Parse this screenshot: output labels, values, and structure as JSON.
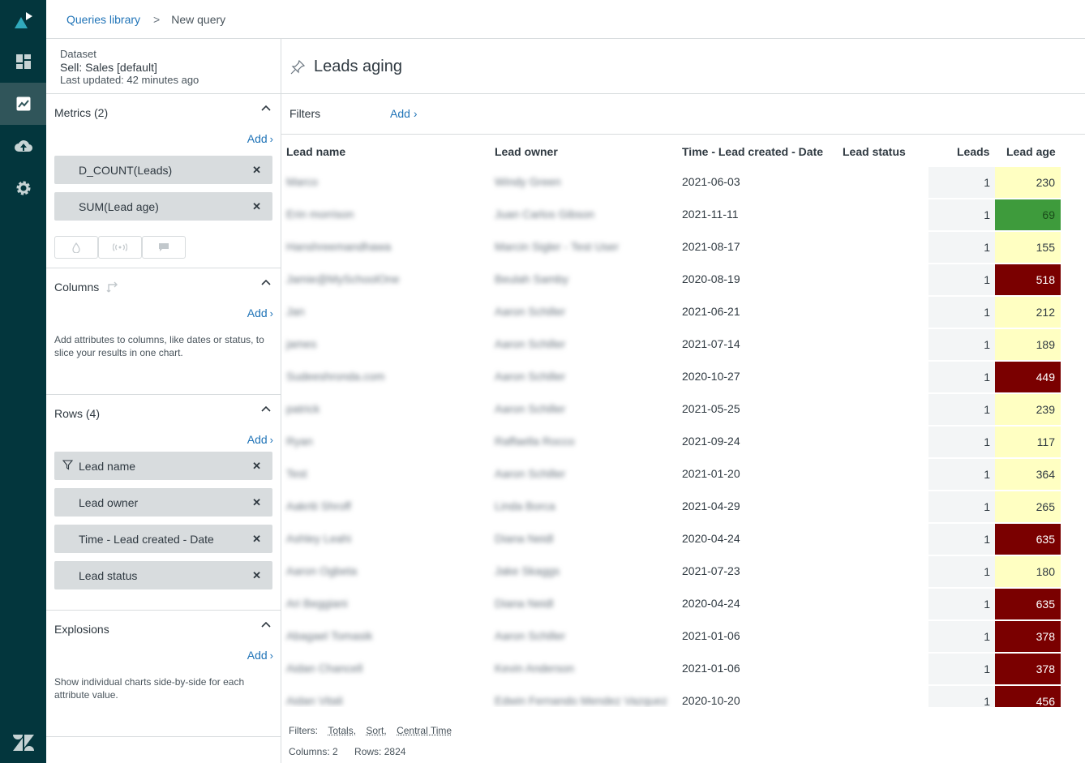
{
  "header": {
    "breadcrumb_link": "Queries library",
    "breadcrumb_sep": ">",
    "breadcrumb_current": "New query"
  },
  "sidebar": {
    "dataset_label": "Dataset",
    "dataset_name": "Sell: Sales [default]",
    "dataset_updated": "Last updated: 42 minutes ago",
    "metrics": {
      "title": "Metrics (2)",
      "add": "Add",
      "items": [
        "D_COUNT(Leads)",
        "SUM(Lead age)"
      ]
    },
    "columns": {
      "title": "Columns",
      "add": "Add",
      "help": "Add attributes to columns, like dates or status, to slice your results in one chart."
    },
    "rows": {
      "title": "Rows (4)",
      "add": "Add",
      "items": [
        "Lead name",
        "Lead owner",
        "Time - Lead created - Date",
        "Lead status"
      ]
    },
    "explosions": {
      "title": "Explosions",
      "add": "Add",
      "help": "Show individual charts side-by-side for each attribute value."
    }
  },
  "main": {
    "title": "Leads aging",
    "filters_label": "Filters",
    "filters_add": "Add",
    "table": {
      "headers": [
        "Lead name",
        "Lead owner",
        "Time - Lead created - Date",
        "Lead status",
        "Leads",
        "Lead age"
      ],
      "rows": [
        {
          "name": "Marco",
          "owner": "Windy Green",
          "date": "2021-06-03",
          "leads": "1",
          "age": "230"
        },
        {
          "name": "Erin morrison",
          "owner": "Juan Carlos Gibson",
          "date": "2021-11-11",
          "leads": "1",
          "age": "69"
        },
        {
          "name": "Hanshreemandhawa",
          "owner": "Marcin Sigler - Test User",
          "date": "2021-08-17",
          "leads": "1",
          "age": "155"
        },
        {
          "name": "Jamie@MySchoolOne",
          "owner": "Beulah Samby",
          "date": "2020-08-19",
          "leads": "1",
          "age": "518"
        },
        {
          "name": "Jan",
          "owner": "Aaron Schiller",
          "date": "2021-06-21",
          "leads": "1",
          "age": "212"
        },
        {
          "name": "james",
          "owner": "Aaron Schiller",
          "date": "2021-07-14",
          "leads": "1",
          "age": "189"
        },
        {
          "name": "Sudeeshronda.com",
          "owner": "Aaron Schiller",
          "date": "2020-10-27",
          "leads": "1",
          "age": "449"
        },
        {
          "name": "patrick",
          "owner": "Aaron Schiller",
          "date": "2021-05-25",
          "leads": "1",
          "age": "239"
        },
        {
          "name": "Ryan",
          "owner": "Raffaella Rocco",
          "date": "2021-09-24",
          "leads": "1",
          "age": "117"
        },
        {
          "name": "Test",
          "owner": "Aaron Schiller",
          "date": "2021-01-20",
          "leads": "1",
          "age": "364"
        },
        {
          "name": "Aakriti Shroff",
          "owner": "Linda Borca",
          "date": "2021-04-29",
          "leads": "1",
          "age": "265"
        },
        {
          "name": "Ashley Leahi",
          "owner": "Diana Neidl",
          "date": "2020-04-24",
          "leads": "1",
          "age": "635"
        },
        {
          "name": "Aaron Ogbeta",
          "owner": "Jake Skaggs",
          "date": "2021-07-23",
          "leads": "1",
          "age": "180"
        },
        {
          "name": "Ari Beggiani",
          "owner": "Diana Neidl",
          "date": "2020-04-24",
          "leads": "1",
          "age": "635"
        },
        {
          "name": "Abagael Tomasik",
          "owner": "Aaron Schiller",
          "date": "2021-01-06",
          "leads": "1",
          "age": "378"
        },
        {
          "name": "Aidan Chancell",
          "owner": "Kevin Anderson",
          "date": "2021-01-06",
          "leads": "1",
          "age": "378"
        },
        {
          "name": "Aidan Vitali",
          "owner": "Edwin Fernando Mendez Vazquez",
          "date": "2020-10-20",
          "leads": "1",
          "age": "456"
        }
      ]
    },
    "footer": {
      "filters_label": "Filters:",
      "filter_links": [
        "Totals,",
        "Sort,",
        "Central Time"
      ],
      "columns_text": "Columns: 2",
      "rows_text": "Rows: 2824"
    }
  },
  "colors": {
    "rail": "#03363d",
    "link": "#1f73b7",
    "age_low": "#ffffc2",
    "age_good": "#3e9b3c",
    "age_high": "#7a0000"
  }
}
